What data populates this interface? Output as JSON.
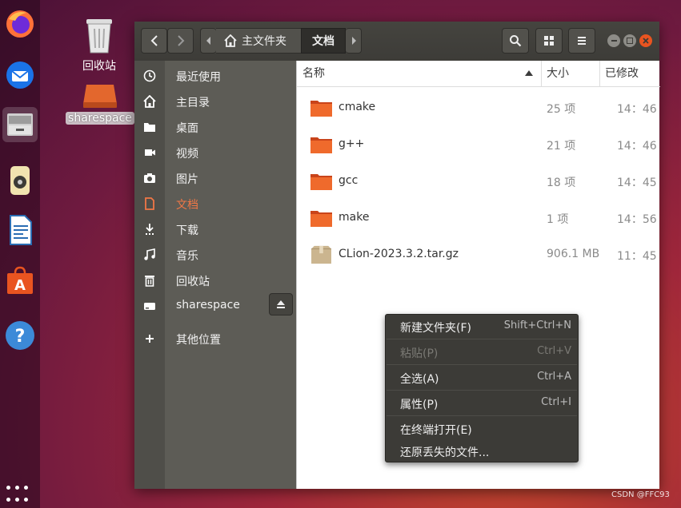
{
  "desktop": {
    "trash_label": "回收站",
    "drive_label": "sharespace"
  },
  "dock": {
    "items": [
      "firefox-icon",
      "thunderbird-icon",
      "files-icon",
      "rhythmbox-icon",
      "libreoffice-writer-icon",
      "software-center-icon",
      "help-icon"
    ],
    "apps_icon": "show-applications-icon"
  },
  "headerbar": {
    "path": [
      "主文件夹",
      "文档"
    ],
    "home_icon": "home-icon",
    "search_icon": "search-icon",
    "view_icon": "grid-view-icon",
    "menu_icon": "hamburger-menu-icon"
  },
  "sidebar": {
    "items": [
      {
        "label": "最近使用",
        "icon": "recent-icon"
      },
      {
        "label": "主目录",
        "icon": "home-icon"
      },
      {
        "label": "桌面",
        "icon": "folder-icon"
      },
      {
        "label": "视频",
        "icon": "video-icon"
      },
      {
        "label": "图片",
        "icon": "camera-icon"
      },
      {
        "label": "文档",
        "icon": "document-icon",
        "active": true
      },
      {
        "label": "下载",
        "icon": "download-icon"
      },
      {
        "label": "音乐",
        "icon": "music-icon"
      },
      {
        "label": "回收站",
        "icon": "trash-icon"
      },
      {
        "label": "sharespace",
        "icon": "drive-icon"
      },
      {
        "label": "其他位置",
        "icon": "plus-icon"
      }
    ]
  },
  "columns": {
    "name": "名称",
    "size": "大小",
    "modified": "已修改"
  },
  "files": [
    {
      "name": "cmake",
      "size": "25 项",
      "modified": "14：46",
      "type": "folder"
    },
    {
      "name": "g++",
      "size": "21 项",
      "modified": "14：46",
      "type": "folder"
    },
    {
      "name": "gcc",
      "size": "18 项",
      "modified": "14：45",
      "type": "folder"
    },
    {
      "name": "make",
      "size": "1 项",
      "modified": "14：56",
      "type": "folder"
    },
    {
      "name": "CLion-2023.3.2.tar.gz",
      "size": "906.1 MB",
      "modified": "11：45",
      "type": "archive"
    }
  ],
  "context_menu": {
    "items": [
      {
        "label": "新建文件夹(F)",
        "shortcut": "Shift+Ctrl+N"
      },
      {
        "label": "粘贴(P)",
        "shortcut": "Ctrl+V",
        "disabled": true
      },
      {
        "label": "全选(A)",
        "shortcut": "Ctrl+A"
      },
      {
        "label": "属性(P)",
        "shortcut": "Ctrl+I"
      },
      {
        "label": "在终端打开(E)",
        "shortcut": ""
      },
      {
        "label": "还原丢失的文件...",
        "shortcut": ""
      }
    ]
  },
  "watermark": "CSDN @FFC93",
  "colors": {
    "accent": "#f07746",
    "folder": "#e95420"
  }
}
